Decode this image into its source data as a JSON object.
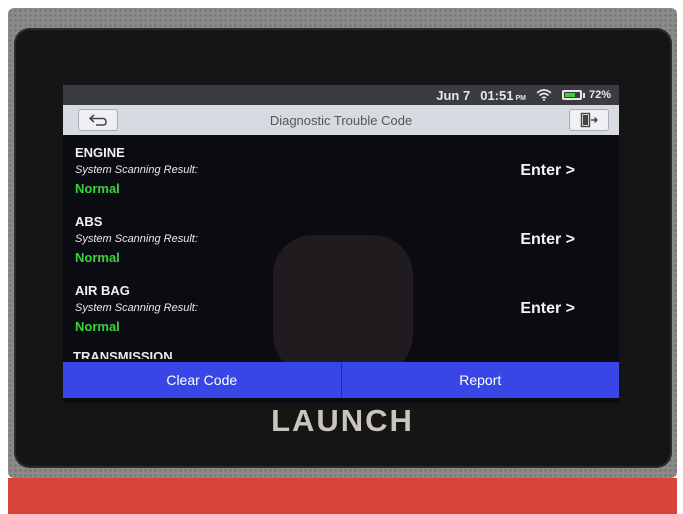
{
  "status_bar": {
    "date": "Jun 7",
    "time": "01:51",
    "ampm": "PM",
    "battery": "72%",
    "battery_level": 0.72,
    "wifi_icon": "wifi-icon"
  },
  "header": {
    "title": "Diagnostic Trouble Code",
    "back_icon": "back-arrow-icon",
    "exit_icon": "exit-icon"
  },
  "systems": [
    {
      "name": "ENGINE",
      "label": "System Scanning Result:",
      "status": "Normal",
      "action": "Enter >"
    },
    {
      "name": "ABS",
      "label": "System Scanning Result:",
      "status": "Normal",
      "action": "Enter >"
    },
    {
      "name": "AIR BAG",
      "label": "System Scanning Result:",
      "status": "Normal",
      "action": "Enter >"
    }
  ],
  "partial_item": "TRANSMISSION",
  "footer": {
    "clear_code": "Clear Code",
    "report": "Report"
  },
  "device": {
    "brand": "LAUNCH"
  },
  "colors": {
    "accent": "#3846e6",
    "status_ok": "#3ad23a",
    "device_base": "#d9443a"
  }
}
